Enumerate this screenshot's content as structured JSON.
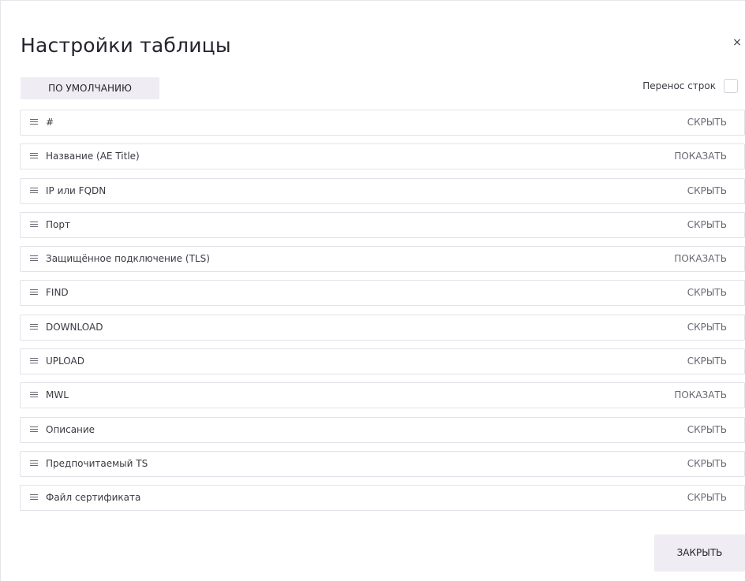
{
  "dialog": {
    "title": "Настройки таблицы",
    "close_icon": "×",
    "default_button_label": "ПО УМОЛЧАНИЮ",
    "wrap_label": "Перенос строк",
    "wrap_checked": false,
    "close_button_label": "ЗАКРЫТЬ"
  },
  "columns": [
    {
      "label": "#",
      "action": "СКРЫТЬ"
    },
    {
      "label": "Название (AE Title)",
      "action": "ПОКАЗАТЬ"
    },
    {
      "label": "IP или FQDN",
      "action": "СКРЫТЬ"
    },
    {
      "label": "Порт",
      "action": "СКРЫТЬ"
    },
    {
      "label": "Защищённое подключение (TLS)",
      "action": "ПОКАЗАТЬ"
    },
    {
      "label": "FIND",
      "action": "СКРЫТЬ"
    },
    {
      "label": "DOWNLOAD",
      "action": "СКРЫТЬ"
    },
    {
      "label": "UPLOAD",
      "action": "СКРЫТЬ"
    },
    {
      "label": "MWL",
      "action": "ПОКАЗАТЬ"
    },
    {
      "label": "Описание",
      "action": "СКРЫТЬ"
    },
    {
      "label": "Предпочитаемый TS",
      "action": "СКРЫТЬ"
    },
    {
      "label": "Файл сертификата",
      "action": "СКРЫТЬ"
    }
  ],
  "icons": {
    "row_handle": "drag-handle-icon",
    "close": "close-icon"
  }
}
